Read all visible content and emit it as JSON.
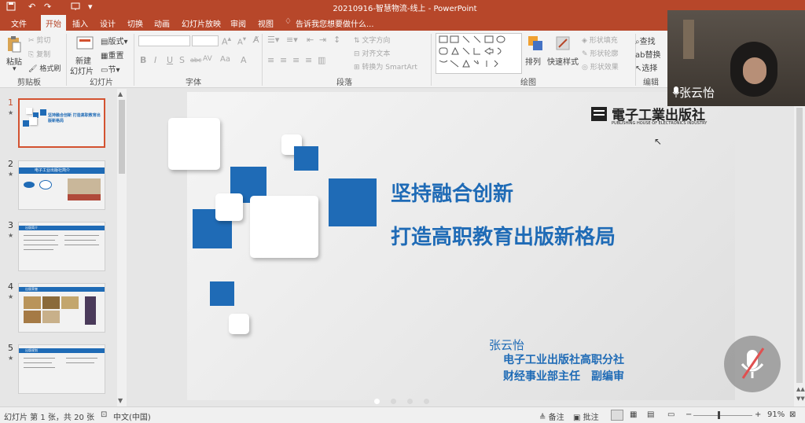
{
  "window": {
    "title": "20210916-智慧物流-线上 - PowerPoint",
    "quick_access": [
      "save-icon",
      "undo-icon",
      "redo-icon",
      "present-icon"
    ]
  },
  "ribbon": {
    "tabs": [
      "文件",
      "开始",
      "插入",
      "设计",
      "切换",
      "动画",
      "幻灯片放映",
      "审阅",
      "视图"
    ],
    "active_tab": "开始",
    "tell_me": "告诉我您想要做什么...",
    "clipboard": {
      "paste": "粘贴",
      "cut": "剪切",
      "copy": "复制",
      "format_painter": "格式刷",
      "label": "剪贴板"
    },
    "slides": {
      "new_slide": "新建",
      "new_slide2": "幻灯片",
      "layout": "版式",
      "reset": "重置",
      "section": "节",
      "label": "幻灯片"
    },
    "font": {
      "label": "字体",
      "bold": "B",
      "italic": "I",
      "underline": "U",
      "shadow": "S",
      "strike": "abc",
      "spacing": "AV",
      "case": "Aa",
      "color": "A"
    },
    "paragraph": {
      "text_direction": "文字方向",
      "align_text": "对齐文本",
      "smartart": "转换为 SmartArt",
      "label": "段落"
    },
    "drawing": {
      "arrange": "排列",
      "quick_styles": "快速样式",
      "shape_fill": "形状填充",
      "shape_outline": "形状轮廓",
      "shape_effects": "形状效果",
      "label": "绘图"
    },
    "editing": {
      "find": "查找",
      "replace": "替换",
      "select": "选择",
      "label": "编辑"
    }
  },
  "thumbnails": [
    {
      "num": "1",
      "title": "坚持融合创新 打造高职教育出版新格局",
      "selected": true
    },
    {
      "num": "2",
      "title": "电子工业出版社简介",
      "selected": false
    },
    {
      "num": "3",
      "title": "出版简介",
      "selected": false
    },
    {
      "num": "4",
      "title": "出版荣誉",
      "selected": false
    },
    {
      "num": "5",
      "title": "出版规划",
      "selected": false
    }
  ],
  "slide": {
    "publisher_logo_cn": "電子工業出版社",
    "publisher_logo_en": "PUBLISHING HOUSE OF ELECTRONICS INDUSTRY",
    "title_line1": "坚持融合创新",
    "title_line2": "打造高职教育出版新格局",
    "author_name": "张云怡",
    "author_org": "电子工业出版社高职分社",
    "author_role": "财经事业部主任　副编审",
    "accent_color": "#1f6bb6"
  },
  "status": {
    "slide_info": "幻灯片 第 1 张，共 20 张",
    "language": "中文(中国)",
    "notes": "备注",
    "comments": "批注",
    "zoom": "91%"
  },
  "video": {
    "participant_name": "张云怡",
    "mic_muted": true
  }
}
